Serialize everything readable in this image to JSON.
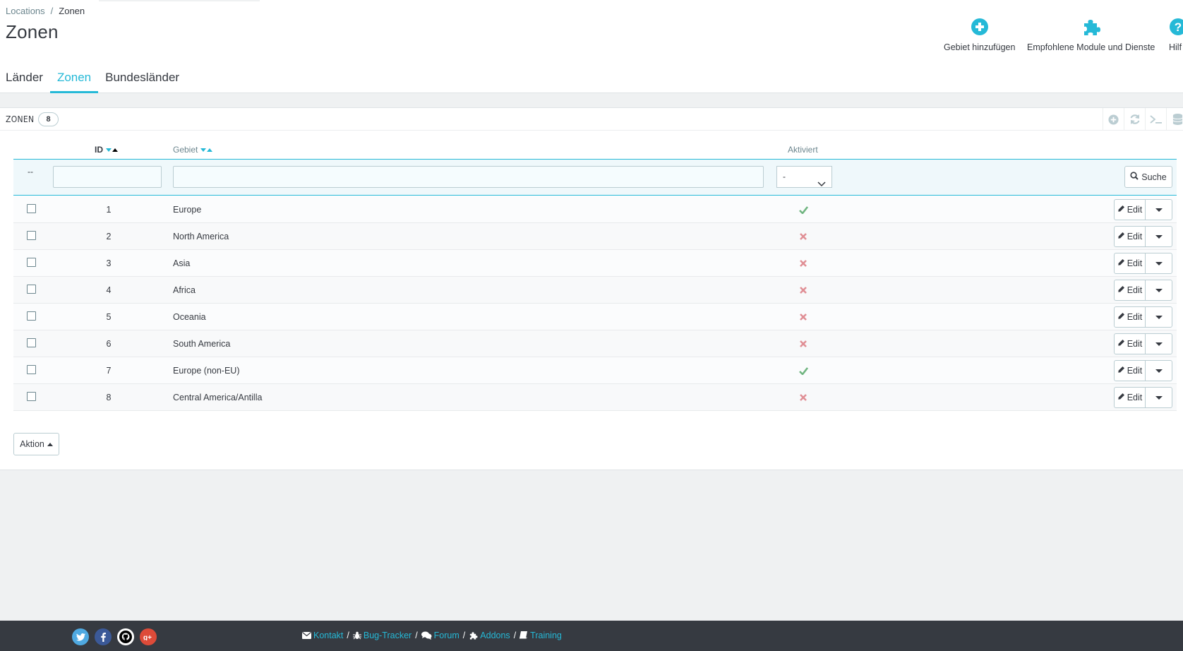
{
  "breadcrumb": {
    "parent": "Locations",
    "separator": "/",
    "current": "Zonen"
  },
  "page_title": "Zonen",
  "toolbar": {
    "add_label": "Gebiet hinzufügen",
    "modules_label": "Empfohlene Module und Dienste",
    "help_label": "Hilf"
  },
  "tabs": [
    {
      "label": "Länder"
    },
    {
      "label": "Zonen"
    },
    {
      "label": "Bundesländer"
    }
  ],
  "panel": {
    "title": "ZONEN",
    "count": "8"
  },
  "table": {
    "headers": {
      "id": "ID",
      "gebiet": "Gebiet",
      "aktiviert": "Aktiviert"
    },
    "filter": {
      "dash": "--",
      "select_value": "-",
      "search_label": "Suche"
    },
    "rows": [
      {
        "id": "1",
        "name": "Europe",
        "active": true
      },
      {
        "id": "2",
        "name": "North America",
        "active": false
      },
      {
        "id": "3",
        "name": "Asia",
        "active": false
      },
      {
        "id": "4",
        "name": "Africa",
        "active": false
      },
      {
        "id": "5",
        "name": "Oceania",
        "active": false
      },
      {
        "id": "6",
        "name": "South America",
        "active": false
      },
      {
        "id": "7",
        "name": "Europe (non-EU)",
        "active": true
      },
      {
        "id": "8",
        "name": "Central America/Antilla",
        "active": false
      }
    ],
    "edit_label": "Edit",
    "bulk_label": "Aktion"
  },
  "footer": {
    "links": [
      "Kontakt",
      "Bug-Tracker",
      "Forum",
      "Addons",
      "Training"
    ]
  },
  "colors": {
    "accent": "#25b9d7",
    "success": "#70b580",
    "danger": "#e08f95",
    "footer": "#363a41"
  }
}
